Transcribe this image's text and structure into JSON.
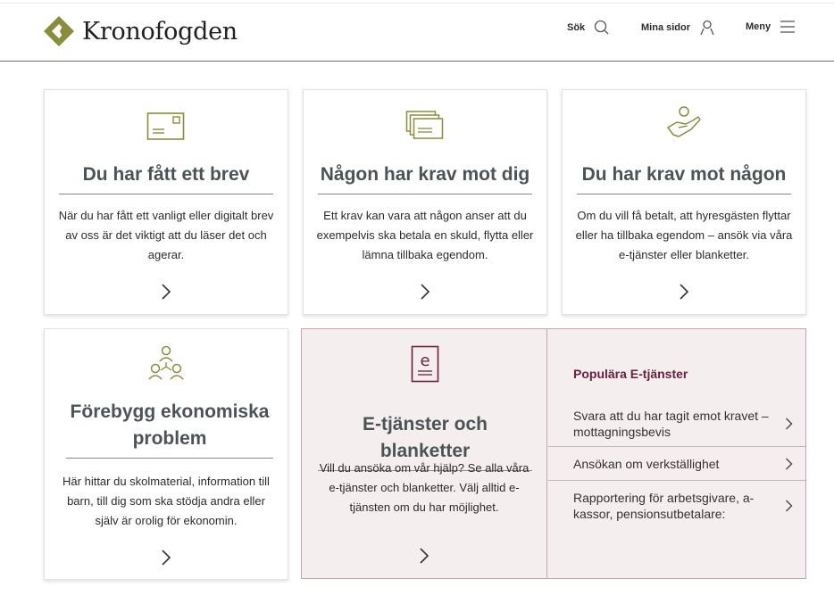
{
  "header": {
    "logo_text": "Kronofogden",
    "brand_color": "#8a8d3a",
    "nav": {
      "search_label": "Sök",
      "my_pages_label": "Mina sidor",
      "menu_label": "Meny"
    }
  },
  "cards": [
    {
      "icon": "envelope-icon",
      "title": "Du har fått ett brev",
      "text": "När du har fått ett vanligt eller digitalt brev av oss är det viktigt att du läser det och agerar."
    },
    {
      "icon": "stacked-letters-icon",
      "title": "Någon har krav mot dig",
      "text": "Ett krav kan vara att någon anser att du exempelvis ska betala en skuld, flytta eller lämna tillbaka egendom."
    },
    {
      "icon": "hand-giving-icon",
      "title": "Du har krav mot någon",
      "text": "Om du vill få betalt, att hyresgästen flyttar eller ha tillbaka egendom – ansök via våra e-tjänster eller blanketter."
    },
    {
      "icon": "people-network-icon",
      "title": "Förebygg ekonomiska problem",
      "text": "Här hittar du skolmaterial, information till barn, till dig som ska stödja andra eller själv är orolig för ekonomin."
    }
  ],
  "eservices": {
    "icon": "e-document-icon",
    "title": "E-tjänster och blanketter",
    "text": "Vill du ansöka om vår hjälp? Se alla våra e-tjänster och blanketter. Välj alltid e-tjänsten om du har möjlighet.",
    "accent_color": "#6a1f3f",
    "popular_title": "Populära E-tjänster",
    "popular_links": [
      "Svara att du har tagit emot kravet – mottagningsbevis",
      "Ansökan om verkställighet",
      "Rapportering för arbetsgivare, a-kassor, pensionsutbetalare:"
    ]
  }
}
